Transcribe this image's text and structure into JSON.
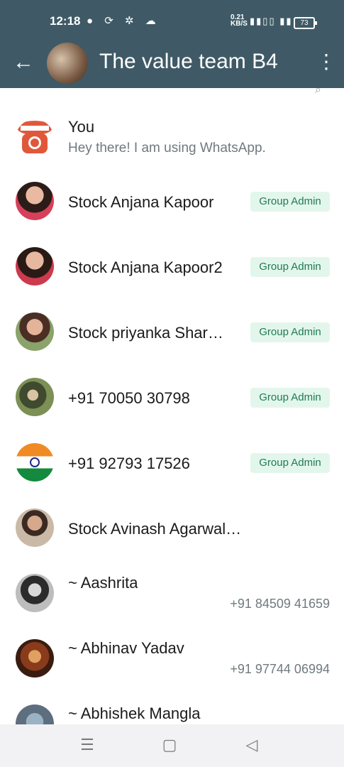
{
  "status_bar": {
    "time": "12:18",
    "net_speed": "0.21",
    "net_unit": "KB/S",
    "battery": "73",
    "icons": [
      "chat-bubble-icon",
      "sync-icon",
      "settings-icon",
      "cloud-icon",
      "signal-icon",
      "wifi-icon"
    ]
  },
  "header": {
    "title": "The value team B4"
  },
  "members": [
    {
      "name": "You",
      "about": "Hey there! I am using WhatsApp.",
      "badge": "",
      "phone": ""
    },
    {
      "name": "Stock Anjana Kapoor",
      "about": "",
      "badge": "Group Admin",
      "phone": ""
    },
    {
      "name": "Stock Anjana Kapoor2",
      "about": "",
      "badge": "Group Admin",
      "phone": ""
    },
    {
      "name": "Stock priyanka Shar…",
      "about": "",
      "badge": "Group Admin",
      "phone": ""
    },
    {
      "name": "+91 70050 30798",
      "about": "",
      "badge": "Group Admin",
      "phone": ""
    },
    {
      "name": "+91 92793 17526",
      "about": "",
      "badge": "Group Admin",
      "phone": ""
    },
    {
      "name": "Stock Avinash Agarwal Mentor",
      "about": "",
      "badge": "",
      "phone": ""
    },
    {
      "name": "~ Aashrita",
      "about": "",
      "badge": "",
      "phone": "+91 84509 41659"
    },
    {
      "name": "~ Abhinav Yadav",
      "about": "",
      "badge": "",
      "phone": "+91 97744 06994"
    },
    {
      "name": "~ Abhishek Mangla",
      "about": "",
      "badge": "",
      "phone": ""
    }
  ],
  "colors": {
    "header_bg": "#3f5a66",
    "badge_bg": "#e3f6ec",
    "badge_text": "#1f7a55"
  }
}
